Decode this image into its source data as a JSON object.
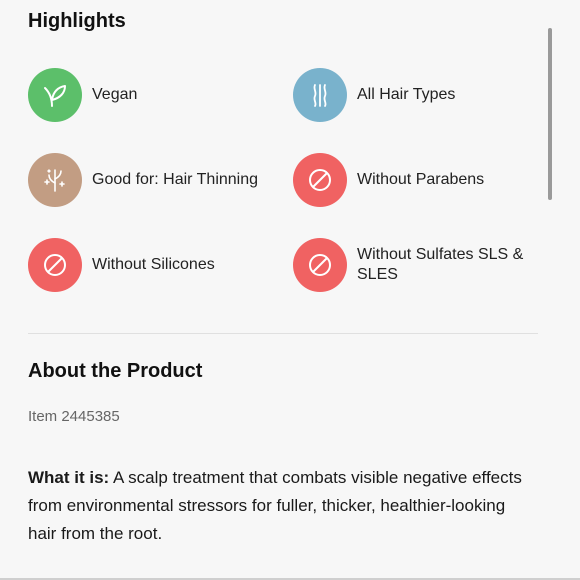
{
  "highlights": {
    "title": "Highlights",
    "items": [
      {
        "label": "Vegan",
        "icon": "leaf-icon",
        "color": "#5cbf6a"
      },
      {
        "label": "All Hair Types",
        "icon": "hair-strands-icon",
        "color": "#79b2cc"
      },
      {
        "label": "Good for: Hair Thinning",
        "icon": "sparkle-strand-icon",
        "color": "#c29d83"
      },
      {
        "label": "Without Parabens",
        "icon": "prohibited-icon",
        "color": "#f06262"
      },
      {
        "label": "Without Silicones",
        "icon": "prohibited-icon",
        "color": "#f06262"
      },
      {
        "label": "Without Sulfates SLS & SLES",
        "icon": "prohibited-icon",
        "color": "#f06262"
      }
    ]
  },
  "about": {
    "title": "About the Product",
    "item_number": "Item 2445385",
    "description_lead": "What it is:",
    "description_text": " A scalp treatment that combats visible negative effects from environmental stressors for fuller, thicker, healthier-looking hair from the root."
  }
}
